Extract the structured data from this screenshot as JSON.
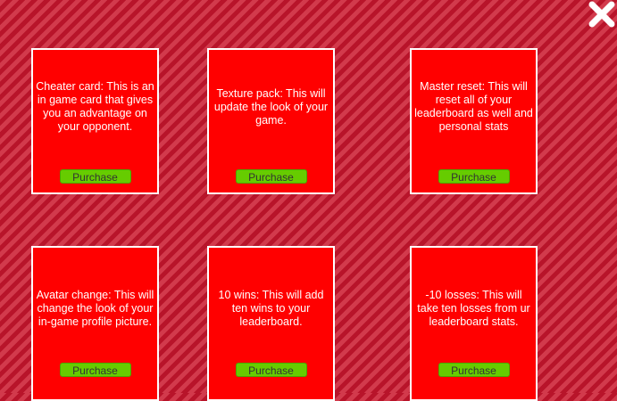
{
  "close_icon": "close-x-icon",
  "colors": {
    "card_background": "#ff0000",
    "card_border": "#ffffff",
    "button_background": "#66cc00",
    "background_stripe_light": "#d23a4c",
    "background_stripe_dark": "#b8142a"
  },
  "items": [
    {
      "description": "Cheater card: This is an in game card that gives you an advantage on your opponent.",
      "button_label": "Purchase"
    },
    {
      "description": "Texture pack: This will update the look of your game.",
      "button_label": "Purchase"
    },
    {
      "description": "Master reset: This will reset all of your leaderboard as well and personal stats",
      "button_label": "Purchase"
    },
    {
      "description": "Avatar change: This will change the look of your in-game profile picture.",
      "button_label": "Purchase"
    },
    {
      "description": "10 wins: This will add ten wins to your leaderboard.",
      "button_label": "Purchase"
    },
    {
      "description": "-10 losses: This will take ten losses from ur leaderboard stats.",
      "button_label": "Purchase"
    }
  ]
}
